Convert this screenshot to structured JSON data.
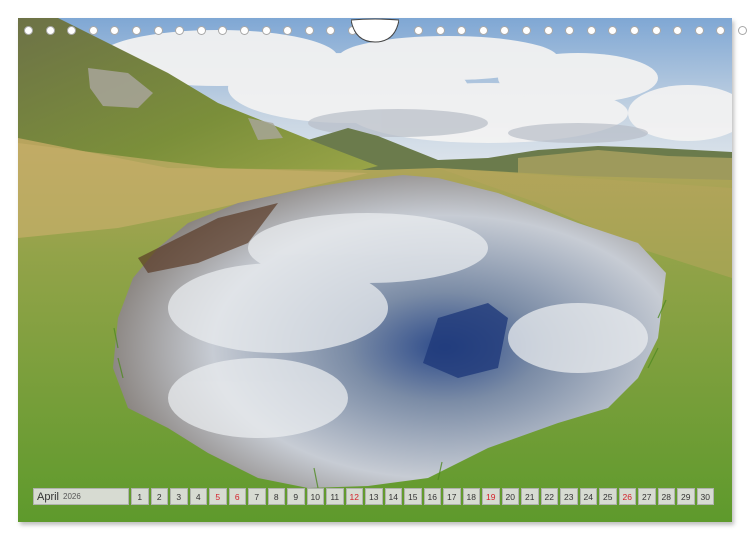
{
  "calendar": {
    "month": "April",
    "year": "2026",
    "days": [
      {
        "n": "1",
        "h": false
      },
      {
        "n": "2",
        "h": false
      },
      {
        "n": "3",
        "h": false
      },
      {
        "n": "4",
        "h": false
      },
      {
        "n": "5",
        "h": true
      },
      {
        "n": "6",
        "h": true
      },
      {
        "n": "7",
        "h": false
      },
      {
        "n": "8",
        "h": false
      },
      {
        "n": "9",
        "h": false
      },
      {
        "n": "10",
        "h": false
      },
      {
        "n": "11",
        "h": false
      },
      {
        "n": "12",
        "h": true
      },
      {
        "n": "13",
        "h": false
      },
      {
        "n": "14",
        "h": false
      },
      {
        "n": "15",
        "h": false
      },
      {
        "n": "16",
        "h": false
      },
      {
        "n": "17",
        "h": false
      },
      {
        "n": "18",
        "h": false
      },
      {
        "n": "19",
        "h": true
      },
      {
        "n": "20",
        "h": false
      },
      {
        "n": "21",
        "h": false
      },
      {
        "n": "22",
        "h": false
      },
      {
        "n": "23",
        "h": false
      },
      {
        "n": "24",
        "h": false
      },
      {
        "n": "25",
        "h": false
      },
      {
        "n": "26",
        "h": true
      },
      {
        "n": "27",
        "h": false
      },
      {
        "n": "28",
        "h": false
      },
      {
        "n": "29",
        "h": false
      },
      {
        "n": "30",
        "h": false
      }
    ]
  },
  "colors": {
    "holiday": "#d4202a",
    "weekday": "#333333"
  },
  "binding": {
    "hole_count": 32
  }
}
